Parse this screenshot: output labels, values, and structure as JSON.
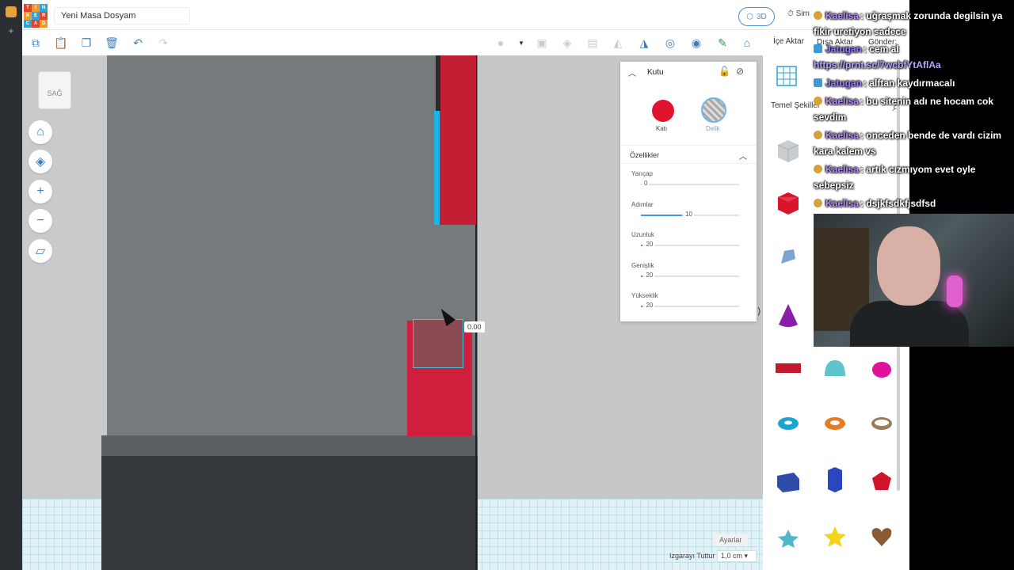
{
  "app": {
    "document_title": "Yeni Masa Dosyam",
    "view_mode": "3D",
    "sim_label": "Sim",
    "import_label": "İçe Aktar",
    "export_label": "Dışa Aktar",
    "send_label": "Gönder:"
  },
  "logo_letters": [
    "T",
    "I",
    "N",
    "K",
    "E",
    "R",
    "C",
    "A",
    "D"
  ],
  "viewport": {
    "view_cube_label": "SAĞ",
    "dimension_value": "0.00",
    "settings_label": "Ayarlar",
    "snap_label": "Izgarayı Tuttur",
    "snap_value": "1,0 cm"
  },
  "inspector": {
    "title": "Kutu",
    "solid_label": "Katı",
    "hole_label": "Delik",
    "properties_title": "Özellikler",
    "properties": [
      {
        "label": "Yarıçap",
        "value": "0",
        "fraction": 0.0
      },
      {
        "label": "Adımlar",
        "value": "10",
        "fraction": 0.42
      },
      {
        "label": "Uzunluk",
        "value": "20",
        "fraction": 0.02
      },
      {
        "label": "Genişlik",
        "value": "20",
        "fraction": 0.02
      },
      {
        "label": "Yükseklik",
        "value": "20",
        "fraction": 0.02
      }
    ]
  },
  "library": {
    "category": "Temel Şekiller"
  },
  "chat": [
    {
      "user": "Kaelisa",
      "icon": "channel-icon",
      "text": ": uğraşmak zorunda degilsin ya fikir uretiyon sadece"
    },
    {
      "user": "Jatugan",
      "icon": "twitch-icon",
      "text": ": cem al"
    },
    {
      "user": "",
      "icon": "",
      "text": "https://prnt.sc/7wcbfYtAflAa"
    },
    {
      "user": "Jatugan",
      "icon": "twitch-icon",
      "text": ": alftan kaydırmacalı"
    },
    {
      "user": "Kaelisa",
      "icon": "channel-icon",
      "text": ": bu sitenin adı ne hocam cok sevdim"
    },
    {
      "user": "Kaelisa",
      "icon": "channel-icon",
      "text": ": onceden bende de vardı cizim kara kalem vs"
    },
    {
      "user": "Kaelisa",
      "icon": "channel-icon",
      "text": ": artık cızmıyom evet oyle sebepsiz"
    },
    {
      "user": "Kaelisa",
      "icon": "channel-icon",
      "text": ": dsjkfsdkfjsdfsd"
    }
  ],
  "colors": {
    "accent": "#3f7fc1",
    "solid_red": "#e0152d",
    "chat_user_kaelisa": "#b68cff",
    "chat_user_jatugan": "#9c7bff",
    "chat_link": "#b4a6ff"
  }
}
